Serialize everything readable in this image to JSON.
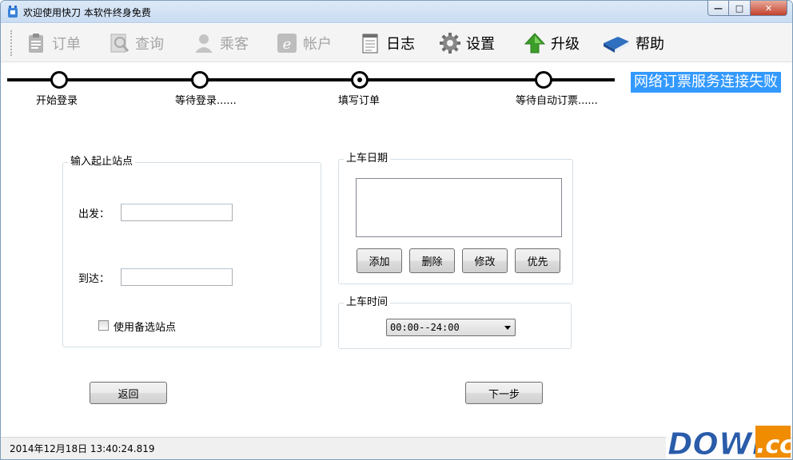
{
  "window": {
    "title": "欢迎使用快刀 本软件终身免费",
    "buttons": {
      "minimize": "—",
      "maximize": "□",
      "close": "✕"
    }
  },
  "toolbar": {
    "items": [
      {
        "label": "订单",
        "icon": "clipboard-icon",
        "enabled": false
      },
      {
        "label": "查询",
        "icon": "search-document-icon",
        "enabled": false
      },
      {
        "label": "乘客",
        "icon": "person-icon",
        "enabled": false
      },
      {
        "label": "帐户",
        "icon": "internet-explorer-icon",
        "enabled": false
      },
      {
        "label": "日志",
        "icon": "notepad-icon",
        "enabled": true
      },
      {
        "label": "设置",
        "icon": "gear-icon",
        "enabled": true
      },
      {
        "label": "升级",
        "icon": "up-arrow-icon",
        "enabled": true
      },
      {
        "label": "帮助",
        "icon": "book-icon",
        "enabled": true
      }
    ]
  },
  "steps": [
    {
      "label": "开始登录"
    },
    {
      "label": "等待登录......"
    },
    {
      "label": "填写订单",
      "current": true
    },
    {
      "label": "等待自动订票......"
    }
  ],
  "status_message": "网络订票服务连接失败",
  "stations": {
    "group_title": "输入起止站点",
    "depart_label": "出发：",
    "depart_value": "",
    "arrive_label": "到达：",
    "arrive_value": "",
    "alt_station_label": "使用备选站点",
    "alt_station_checked": false
  },
  "date": {
    "group_title": "上车日期",
    "buttons": [
      "添加",
      "删除",
      "修改",
      "优先"
    ]
  },
  "time": {
    "group_title": "上车时间",
    "selected": "00:00--24:00"
  },
  "nav": {
    "back": "返回",
    "next": "下一步"
  },
  "statusbar": {
    "timestamp": "2014年12月18日 13:40:24.819"
  },
  "watermark": {
    "text": "DOWN.cc"
  },
  "colors": {
    "status_bg": "#3399ff",
    "watermark_blue": "#2a5caa",
    "watermark_orange": "#f08c00"
  }
}
